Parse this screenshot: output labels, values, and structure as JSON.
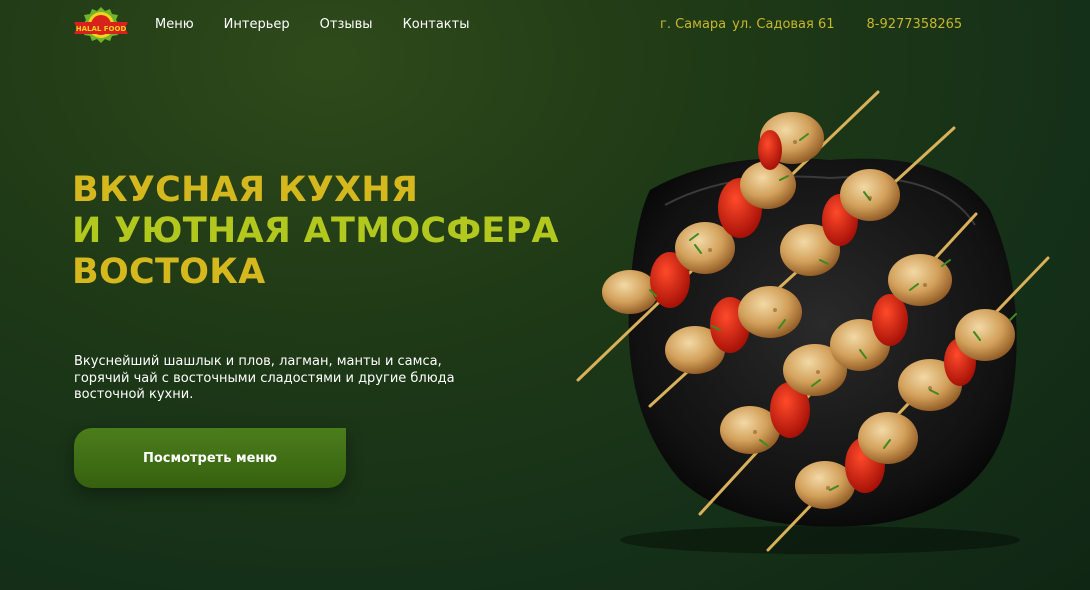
{
  "brand": {
    "logo_text": "HALAL FOOD",
    "colors": {
      "red": "#d8211c",
      "green": "#6fb52c",
      "yellow": "#f0d31a"
    }
  },
  "nav": {
    "items": [
      "Меню",
      "Интерьер",
      "Отзывы",
      "Контакты"
    ]
  },
  "contacts": {
    "city": "г. Самара",
    "address": "ул. Садовая 61",
    "phone": "8-9277358265"
  },
  "hero": {
    "title_lines": [
      "ВКУСНАЯ КУХНЯ",
      "И УЮТНАЯ АТМОСФЕРА",
      "ВОСТОКА"
    ],
    "description_lines": [
      "Вкуснейший шашлык и плов, лагман, манты и самса,",
      "горячий чай с восточными сладостями и другие блюда",
      "восточной кухни."
    ],
    "cta_label": "Посмотреть меню"
  },
  "image": {
    "icon": "kebab-plate-image"
  },
  "colors": {
    "background": "#1c3517",
    "title_gold": "#d4b81e",
    "title_lime": "#b2c81e",
    "contacts_gold": "#c8b62b",
    "button_green": "#3f6f14"
  }
}
